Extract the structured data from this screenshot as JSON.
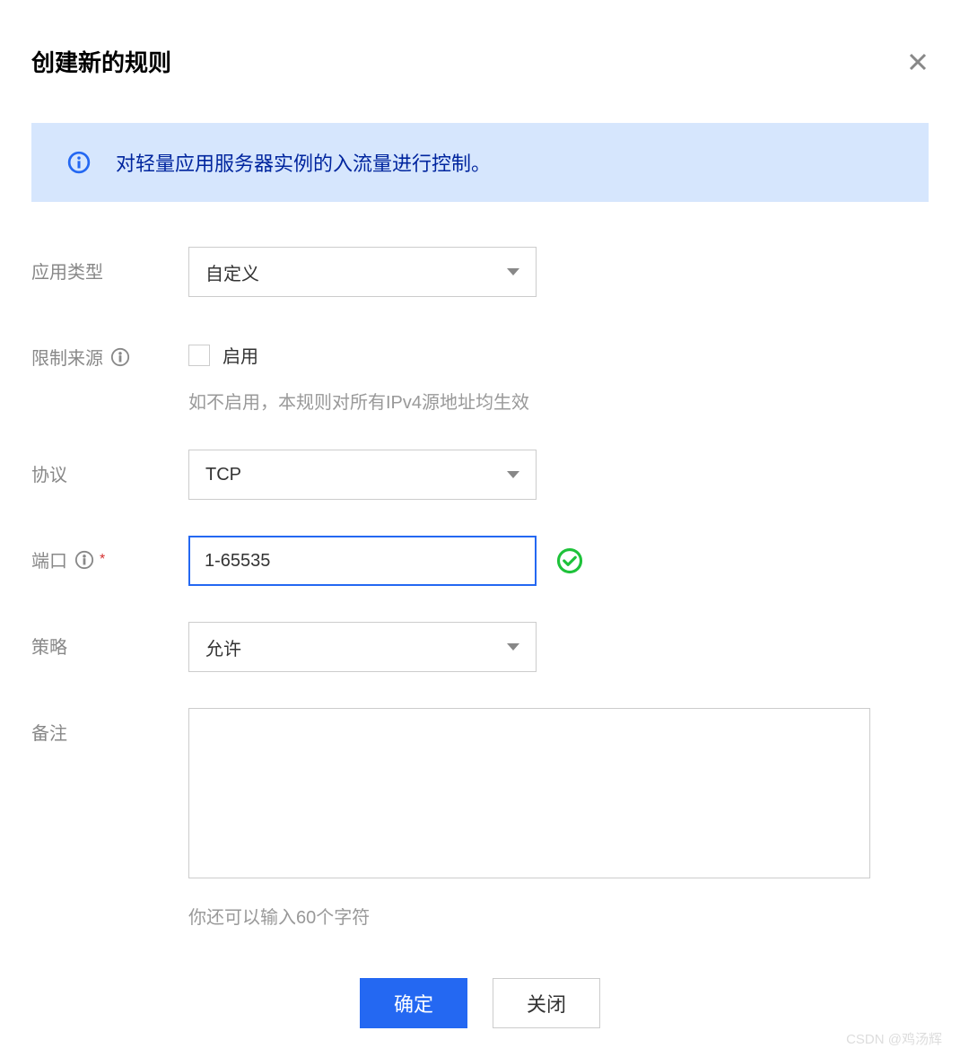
{
  "header": {
    "title": "创建新的规则"
  },
  "banner": {
    "text": "对轻量应用服务器实例的入流量进行控制。"
  },
  "fields": {
    "appType": {
      "label": "应用类型",
      "value": "自定义"
    },
    "limitSource": {
      "label": "限制来源",
      "checkboxLabel": "启用",
      "helpText": "如不启用，本规则对所有IPv4源地址均生效"
    },
    "protocol": {
      "label": "协议",
      "value": "TCP"
    },
    "port": {
      "label": "端口",
      "value": "1-65535"
    },
    "policy": {
      "label": "策略",
      "value": "允许"
    },
    "remark": {
      "label": "备注",
      "helpText": "你还可以输入60个字符"
    }
  },
  "buttons": {
    "confirm": "确定",
    "close": "关闭"
  },
  "watermark": "CSDN @鸡汤辉"
}
